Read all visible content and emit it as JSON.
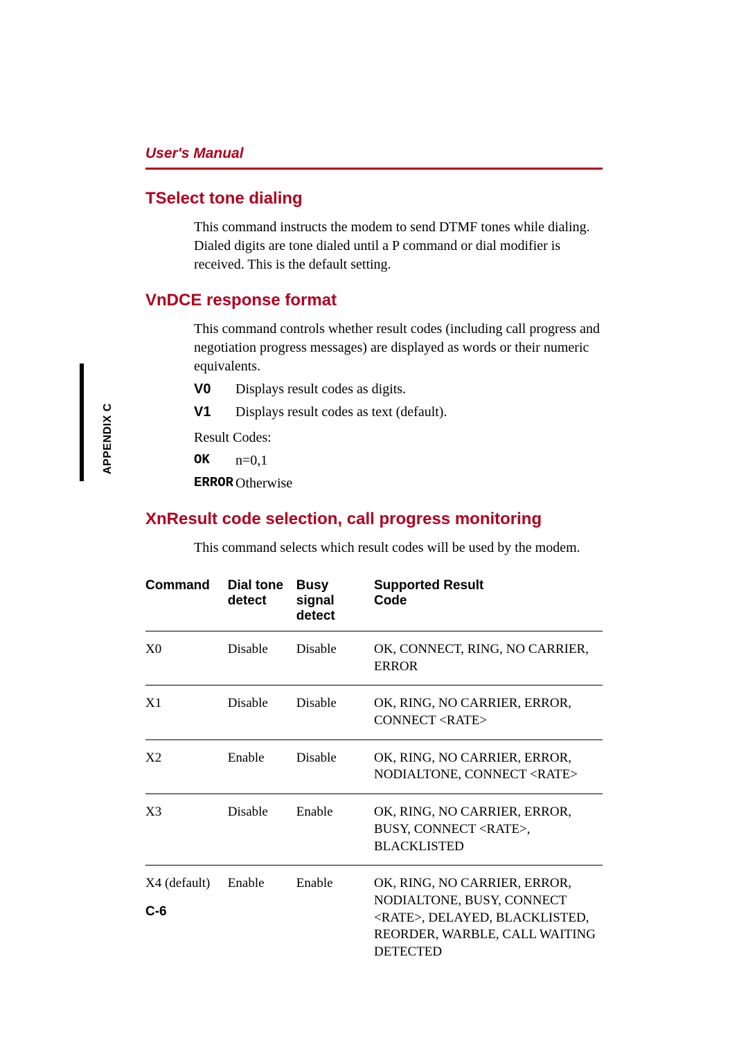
{
  "header": "User's Manual",
  "side_tab": "APPENDIX C",
  "page_num": "C-6",
  "sections": {
    "tselect": {
      "heading": "TSelect tone dialing",
      "body": "This command instructs the modem to send DTMF tones while dialing. Dialed digits are tone dialed until a P command or dial modifier is received. This is the default setting."
    },
    "vndce": {
      "heading": "VnDCE response format",
      "body": "This command controls whether result codes (including call progress and negotiation progress messages) are displayed as words or their numeric equivalents.",
      "v0_key": "V0",
      "v0_val": "Displays result codes as digits.",
      "v1_key": "V1",
      "v1_val": "Displays result codes as text (default).",
      "result_label": "Result Codes:",
      "ok_key": "OK",
      "ok_val": "n=0,1",
      "err_key": "ERROR",
      "err_val": "Otherwise"
    },
    "xn": {
      "heading": "XnResult code selection, call progress monitoring",
      "body": "This command selects which result codes will be used by the modem."
    }
  },
  "table": {
    "headers": {
      "cmd": "Command",
      "dt1": "Dial tone",
      "dt2": "detect",
      "bs1": "Busy signal",
      "bs2": "detect",
      "res1": "Supported Result",
      "res2": "Code"
    },
    "rows": [
      {
        "cmd": "X0",
        "dt": "Disable",
        "bs": "Disable",
        "res": "OK, CONNECT, RING, NO CARRIER, ERROR"
      },
      {
        "cmd": "X1",
        "dt": "Disable",
        "bs": "Disable",
        "res": "OK, RING, NO CARRIER, ERROR, CONNECT <RATE>"
      },
      {
        "cmd": "X2",
        "dt": "Enable",
        "bs": "Disable",
        "res": "OK, RING, NO CARRIER, ERROR, NODIALTONE, CONNECT <RATE>"
      },
      {
        "cmd": "X3",
        "dt": "Disable",
        "bs": "Enable",
        "res": "OK, RING, NO CARRIER, ERROR, BUSY, CONNECT <RATE>, BLACKLISTED"
      },
      {
        "cmd": "X4 (default)",
        "dt": "Enable",
        "bs": "Enable",
        "res": "OK, RING, NO CARRIER, ERROR, NODIALTONE, BUSY, CONNECT <RATE>, DELAYED, BLACKLISTED, REORDER, WARBLE, CALL WAITING DETECTED"
      }
    ]
  }
}
